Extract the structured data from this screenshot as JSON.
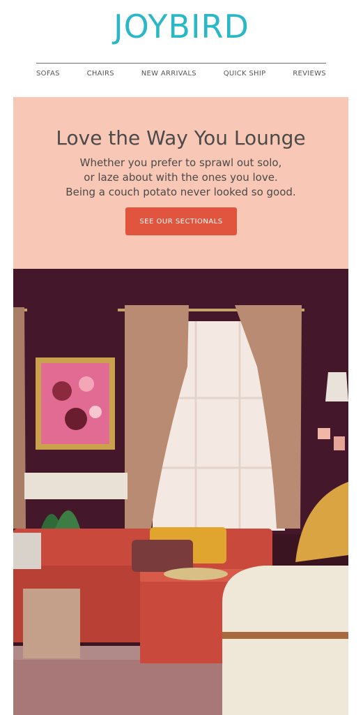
{
  "brand": {
    "logo_text": "JOYBIRD",
    "accent": "#2bb8c6"
  },
  "nav": {
    "items": [
      "SOFAS",
      "CHAIRS",
      "NEW ARRIVALS",
      "QUICK SHIP",
      "REVIEWS"
    ]
  },
  "hero": {
    "title": "Love the Way You Lounge",
    "subtitle_lines": [
      "Whether you prefer to sprawl out solo,",
      "or laze about with the ones you love.",
      "Being a couch potato never looked so good."
    ],
    "cta_label": "SEE OUR SECTIONALS",
    "background": "#f9c7b5",
    "cta_color": "#e1553e"
  },
  "photo": {
    "wall_color": "#3a1420",
    "sofa_color": "#c94a3c"
  }
}
